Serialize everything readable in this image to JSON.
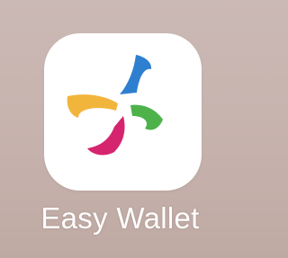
{
  "app": {
    "name": "Easy Wallet",
    "icon": "easy-wallet-pinwheel-logo"
  },
  "colors": {
    "background": "#c7b3ae",
    "icon_background": "#ffffff",
    "label_text": "#ffffff",
    "logo_blue": "#2f7fd1",
    "logo_yellow": "#f2b53c",
    "logo_green": "#4db24a",
    "logo_magenta": "#d6256f"
  }
}
